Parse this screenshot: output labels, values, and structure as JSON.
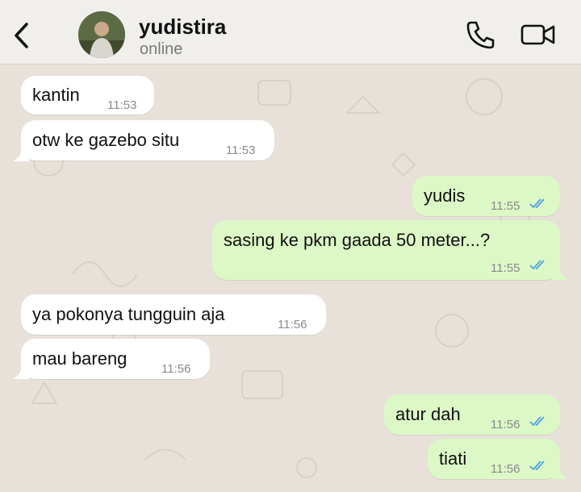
{
  "header": {
    "contact_name": "yudistira",
    "status": "online",
    "icons": {
      "back": "chevron-left-icon",
      "call": "phone-icon",
      "video": "video-camera-icon"
    }
  },
  "messages": [
    {
      "direction": "in",
      "text": "kantin",
      "time": "11:53"
    },
    {
      "direction": "in",
      "text": "otw ke gazebo situ",
      "time": "11:53"
    },
    {
      "direction": "out",
      "text": "yudis",
      "time": "11:55",
      "read": true
    },
    {
      "direction": "out",
      "text": "sasing ke pkm gaada 50 meter...?",
      "time": "11:55",
      "read": true
    },
    {
      "direction": "in",
      "text": "ya pokonya tungguin aja",
      "time": "11:56"
    },
    {
      "direction": "in",
      "text": "mau bareng",
      "time": "11:56"
    },
    {
      "direction": "out",
      "text": "atur dah",
      "time": "11:56",
      "read": true
    },
    {
      "direction": "out",
      "text": "tiati",
      "time": "11:56",
      "read": true
    }
  ],
  "colors": {
    "incoming_bubble": "#ffffff",
    "outgoing_bubble": "#dcf8c6",
    "read_ticks": "#4fa3e0",
    "wallpaper": "#e7e1da"
  }
}
